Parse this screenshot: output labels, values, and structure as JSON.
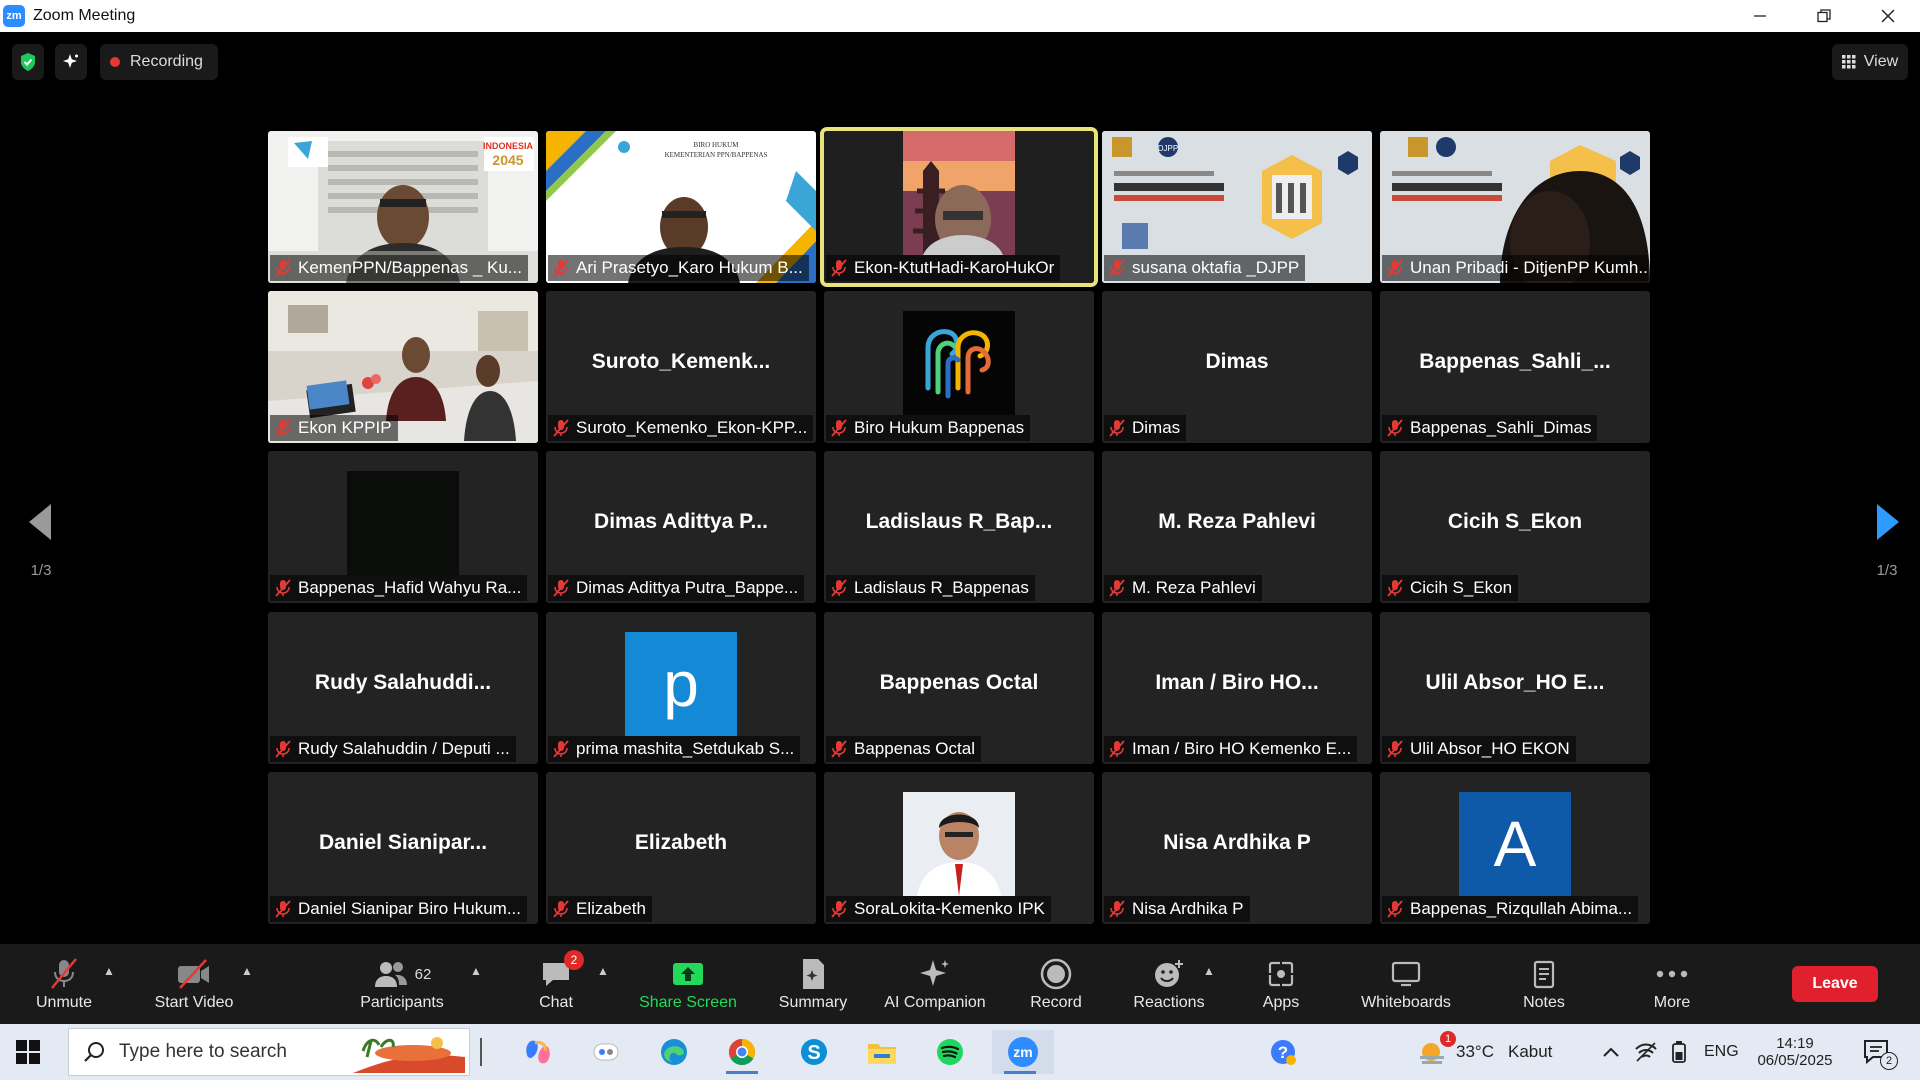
{
  "window": {
    "title": "Zoom Meeting",
    "app_icon": "zm"
  },
  "topbar": {
    "recording_label": "Recording",
    "view_label": "View"
  },
  "pagination": {
    "left": "1/3",
    "right": "1/3"
  },
  "tiles": [
    {
      "big": "",
      "label": "KemenPPN/Bappenas _ Ku...",
      "kind": "video"
    },
    {
      "big": "",
      "label": "Ari Prasetyo_Karo Hukum B...",
      "kind": "video"
    },
    {
      "big": "",
      "label": "Ekon-KtutHadi-KaroHukOr",
      "kind": "video",
      "active": true
    },
    {
      "big": "",
      "label": "susana oktafia _DJPP",
      "kind": "video"
    },
    {
      "big": "",
      "label": "Unan Pribadi - DitjenPP Kumh...",
      "kind": "video"
    },
    {
      "big": "",
      "label": "Ekon KPPIP",
      "kind": "video"
    },
    {
      "big": "Suroto_Kemenk...",
      "label": "Suroto_Kemenko_Ekon-KPP...",
      "kind": "name"
    },
    {
      "big": "",
      "label": "Biro Hukum Bappenas",
      "kind": "logo"
    },
    {
      "big": "Dimas",
      "label": "Dimas",
      "kind": "name"
    },
    {
      "big": "Bappenas_Sahli_...",
      "label": "Bappenas_Sahli_Dimas",
      "kind": "name"
    },
    {
      "big": "",
      "label": "Bappenas_Hafid Wahyu Ra...",
      "kind": "blackthumb"
    },
    {
      "big": "Dimas Adittya P...",
      "label": "Dimas Adittya Putra_Bappe...",
      "kind": "name"
    },
    {
      "big": "Ladislaus R_Bap...",
      "label": "Ladislaus R_Bappenas",
      "kind": "name"
    },
    {
      "big": "M. Reza Pahlevi",
      "label": "M. Reza Pahlevi",
      "kind": "name"
    },
    {
      "big": "Cicih S_Ekon",
      "label": "Cicih S_Ekon",
      "kind": "name"
    },
    {
      "big": "Rudy Salahuddi...",
      "label": "Rudy Salahuddin / Deputi ...",
      "kind": "name"
    },
    {
      "big": "p",
      "label": "prima mashita_Setdukab S...",
      "kind": "letter",
      "color": "#1489d6"
    },
    {
      "big": "Bappenas Octal",
      "label": "Bappenas Octal",
      "kind": "name"
    },
    {
      "big": "Iman / Biro HO...",
      "label": "Iman / Biro HO Kemenko E...",
      "kind": "name"
    },
    {
      "big": "Ulil Absor_HO E...",
      "label": "Ulil Absor_HO EKON",
      "kind": "name"
    },
    {
      "big": "Daniel Sianipar...",
      "label": "Daniel Sianipar Biro Hukum...",
      "kind": "name"
    },
    {
      "big": "Elizabeth",
      "label": "Elizabeth",
      "kind": "name"
    },
    {
      "big": "",
      "label": "SoraLokita-Kemenko IPK",
      "kind": "portrait"
    },
    {
      "big": "Nisa Ardhika P",
      "label": "Nisa Ardhika P",
      "kind": "name"
    },
    {
      "big": "A",
      "label": "Bappenas_Rizqullah Abima...",
      "kind": "letter",
      "color": "#0f5aa8"
    }
  ],
  "toolbar": {
    "unmute": "Unmute",
    "start_video": "Start Video",
    "participants": "Participants",
    "participants_count": "62",
    "chat": "Chat",
    "chat_badge": "2",
    "share_screen": "Share Screen",
    "summary": "Summary",
    "ai_companion": "AI Companion",
    "record": "Record",
    "reactions": "Reactions",
    "apps": "Apps",
    "whiteboards": "Whiteboards",
    "notes": "Notes",
    "more": "More",
    "leave": "Leave"
  },
  "taskbar": {
    "search_placeholder": "Type here to search",
    "weather_temp": "33°C",
    "weather_desc": "Kabut",
    "language": "ENG",
    "time": "14:19",
    "date": "06/05/2025",
    "notif_count": "2",
    "weather_badge": "1"
  },
  "colors": {
    "accent": "#2d8cff",
    "share_green": "#23d959",
    "leave_red": "#e0212d",
    "active_border": "#e8e37a"
  }
}
